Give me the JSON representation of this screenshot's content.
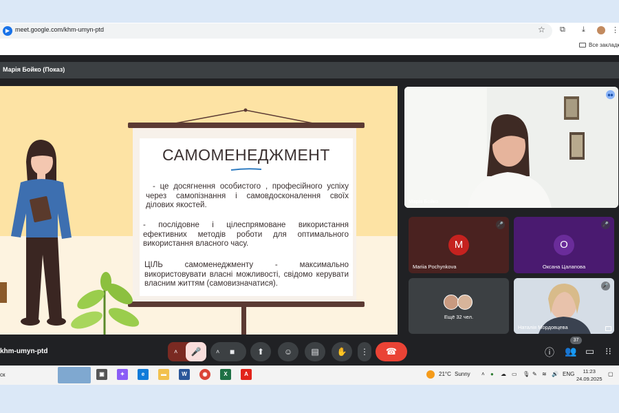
{
  "browser": {
    "url": "meet.google.com/khm-umyn-ptd",
    "bookmarks_label": "Все закладки"
  },
  "meet": {
    "presenter_label": "Марія Бойко (Показ)",
    "meeting_code": "khm-umyn-ptd",
    "participant_count": "37"
  },
  "slide": {
    "title": "САМОМЕНЕДЖМЕНТ",
    "para1": "- це досягнення особистого , професійного успіху через самопізнання і самовдосконалення своїх ділових якостей.",
    "para2": "- послідовне і цілеспрямоване використання ефективних методів роботи для оптимального використання власного часу.",
    "para3": "ЦІЛЬ самоменеджменту - максимально використовувати власні можливості, свідомо керувати власним життям (самовизначатися)."
  },
  "tiles": {
    "main": {
      "name": "Марія Бойко"
    },
    "t1": {
      "name": "Mariia Pochynkova",
      "initial": "M",
      "color": "#c5221f"
    },
    "t2": {
      "name": "Оксана Цалапова",
      "initial": "O",
      "color": "#7b1fa2"
    },
    "more": {
      "label": "Ещё 32 чел."
    },
    "t4": {
      "name": "Наталія Мордовцева"
    }
  },
  "taskbar": {
    "search_fragment": "ск",
    "weather_temp": "21°C",
    "weather_text": "Sunny",
    "language": "ENG",
    "time": "11:23",
    "date": "24.09.2025"
  },
  "colors": {
    "end_call": "#ea4335",
    "muted_btn": "#f9dedc",
    "slide_bg": "#fde3a4"
  }
}
